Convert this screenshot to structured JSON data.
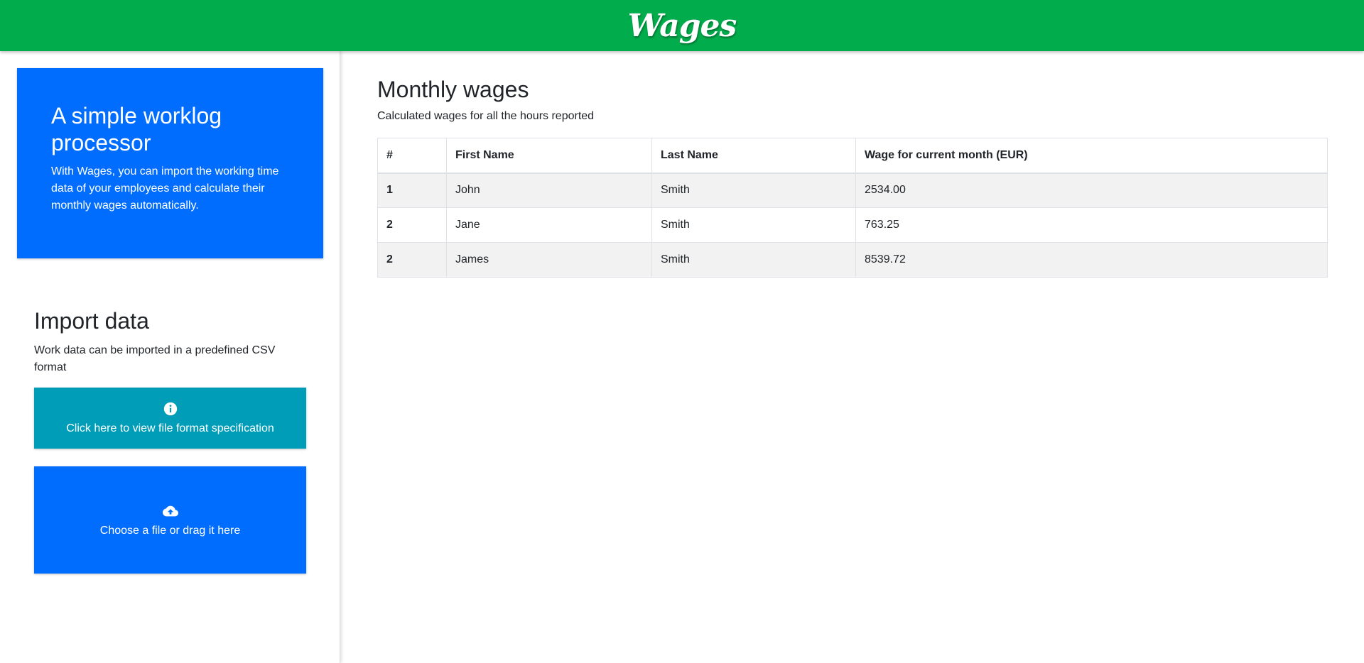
{
  "app": {
    "title": "Wages"
  },
  "colors": {
    "topbar": "#00ac4b",
    "primary": "#006dff",
    "info": "#009db8"
  },
  "sidebar": {
    "intro": {
      "title": "A simple worklog processor",
      "text": "With Wages, you can import the working time data of your employees and calculate their monthly wages automatically."
    },
    "import": {
      "title": "Import data",
      "text": "Work data can be imported in a predefined CSV format",
      "spec_button": {
        "icon": "info-icon",
        "label": "Click here to view file format specification"
      },
      "upload": {
        "icon": "cloud-upload-icon",
        "label": "Choose a file or drag it here"
      }
    }
  },
  "main": {
    "title": "Monthly wages",
    "subtitle": "Calculated wages for all the hours reported",
    "table": {
      "headers": [
        "#",
        "First Name",
        "Last Name",
        "Wage for current month (EUR)"
      ],
      "rows": [
        [
          "1",
          "John",
          "Smith",
          "2534.00"
        ],
        [
          "2",
          "Jane",
          "Smith",
          "763.25"
        ],
        [
          "2",
          "James",
          "Smith",
          "8539.72"
        ]
      ]
    }
  }
}
